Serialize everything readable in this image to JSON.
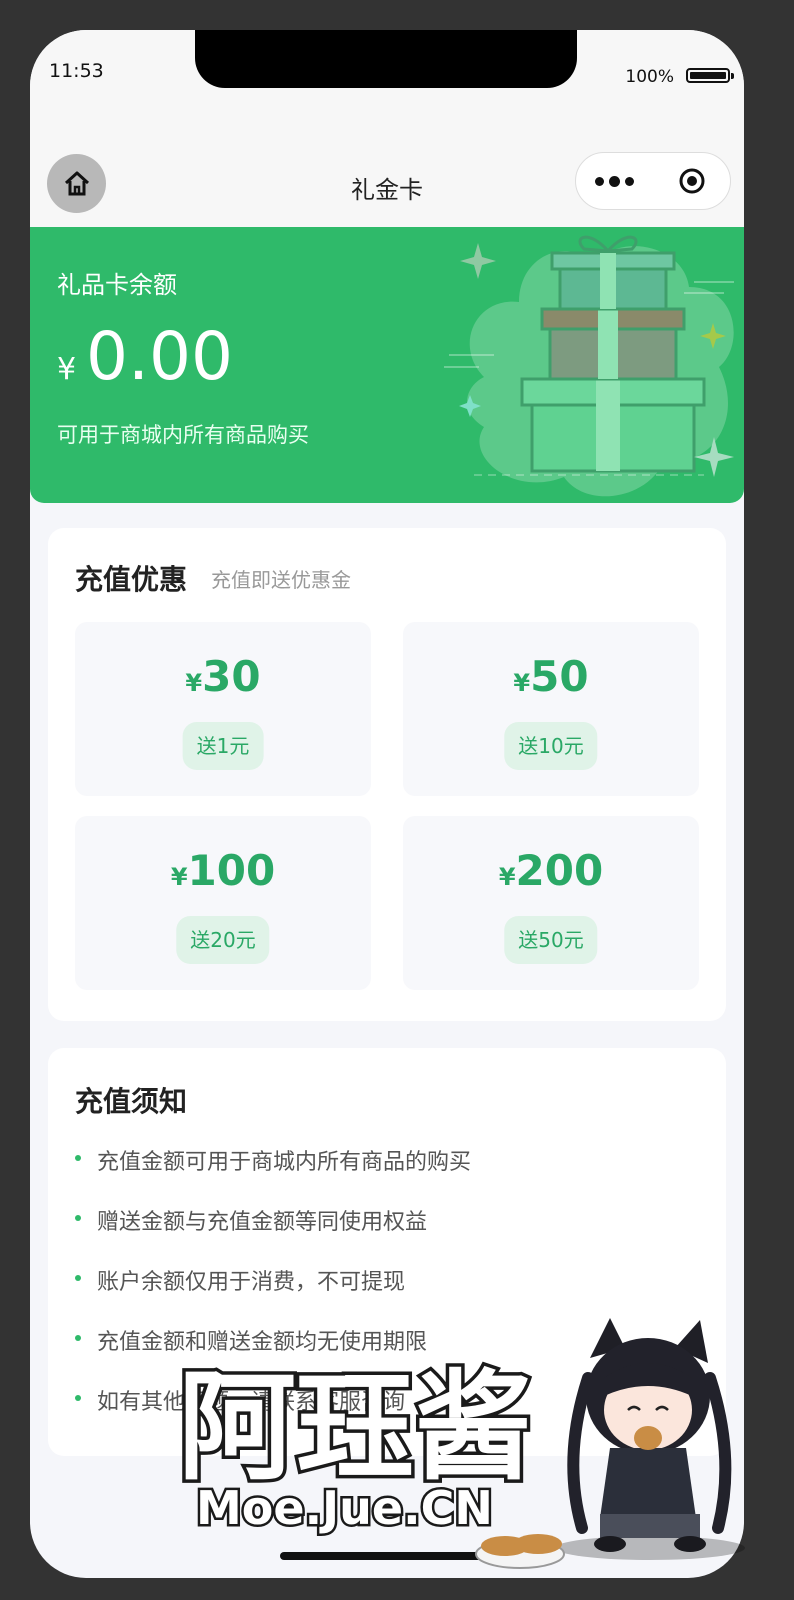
{
  "status_bar": {
    "time": "11:53",
    "battery": "100%"
  },
  "nav": {
    "title": "礼金卡",
    "home_icon": "home-icon",
    "more_icon": "more-dots-icon",
    "close_icon": "target-icon"
  },
  "balance": {
    "label": "礼品卡余额",
    "currency": "¥",
    "amount": "0.00",
    "description": "可用于商城内所有商品购买"
  },
  "promo": {
    "title": "充值优惠",
    "subtitle": "充值即送优惠金",
    "options": [
      {
        "currency": "¥",
        "amount": "30",
        "bonus": "送1元"
      },
      {
        "currency": "¥",
        "amount": "50",
        "bonus": "送10元"
      },
      {
        "currency": "¥",
        "amount": "100",
        "bonus": "送20元"
      },
      {
        "currency": "¥",
        "amount": "200",
        "bonus": "送50元"
      }
    ]
  },
  "notice": {
    "title": "充值须知",
    "items": [
      "充值金额可用于商城内所有商品的购买",
      "赠送金额与充值金额等同使用权益",
      "账户余额仅用于消费，不可提现",
      "充值金额和赠送金额均无使用期限",
      "如有其他问题，请联系客服咨询"
    ]
  },
  "watermark": {
    "title": "阿珏酱",
    "url": "Moe.Jue.CN"
  },
  "colors": {
    "primary": "#2fba6a",
    "price": "#2aa866",
    "bonus_bg": "#e0f3e8",
    "page_bg": "#f5f6fa"
  }
}
